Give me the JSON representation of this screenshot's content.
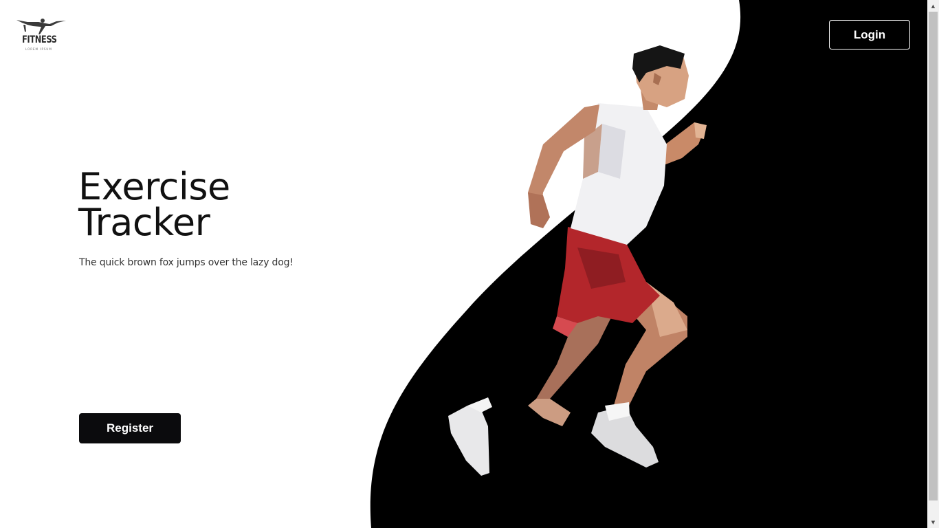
{
  "brand": {
    "name": "FITNESS",
    "tagline": "LOREM IPSUM"
  },
  "header": {
    "login_label": "Login"
  },
  "hero": {
    "title_line1": "Exercise",
    "title_line2": "Tracker",
    "subtitle": "The quick brown fox jumps over the lazy dog!",
    "register_label": "Register"
  },
  "colors": {
    "background": "#ffffff",
    "wave": "#000000",
    "button": "#0b0b0d",
    "button_text": "#ffffff",
    "runner_shorts": "#b3262b",
    "runner_skin": "#d39a78"
  },
  "icons": {
    "logo": "fitness-plank-figure-icon",
    "runner": "low-poly-runner-illustration"
  }
}
